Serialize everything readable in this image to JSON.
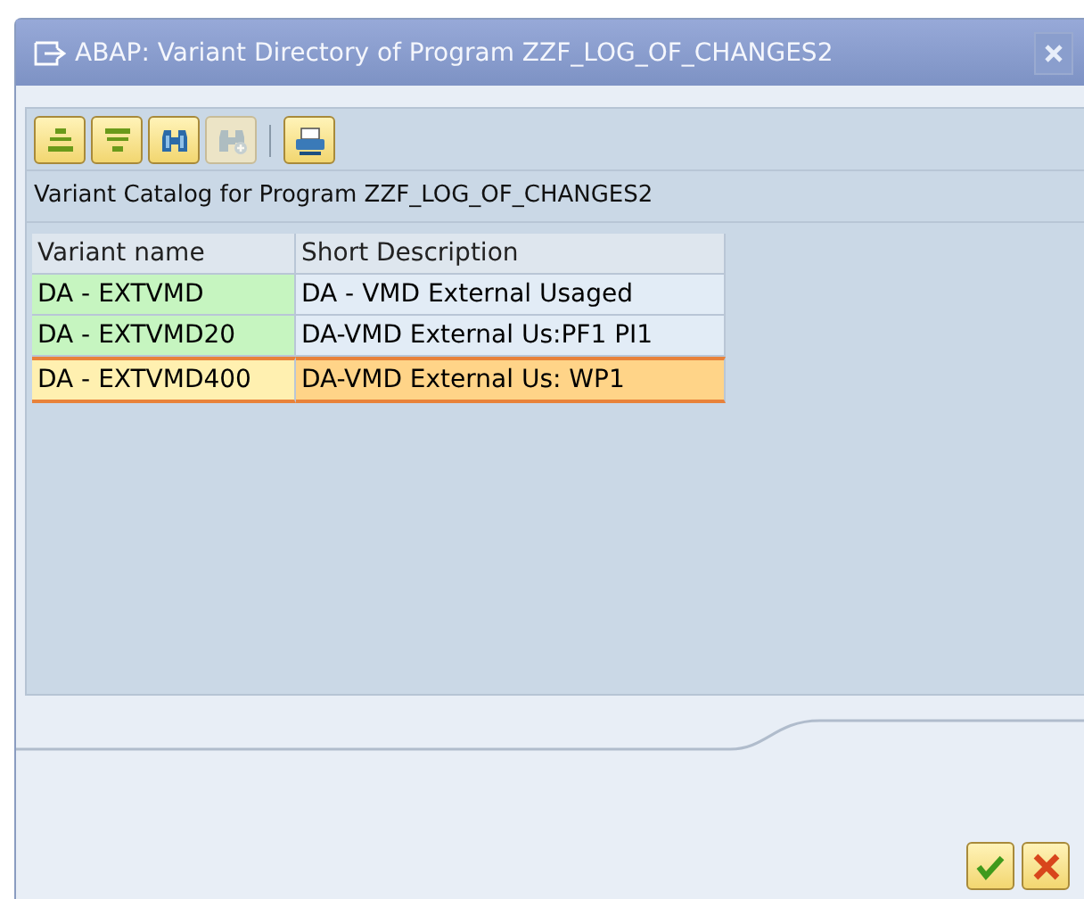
{
  "window": {
    "title": "ABAP: Variant Directory of Program ZZF_LOG_OF_CHANGES2"
  },
  "toolbar_groups": [
    {
      "buttons": [
        {
          "kind": "expand",
          "disabled": false
        },
        {
          "kind": "collapse",
          "disabled": false
        },
        {
          "kind": "find",
          "disabled": false
        },
        {
          "kind": "find-next",
          "disabled": true
        }
      ]
    },
    {
      "buttons": [
        {
          "kind": "print",
          "disabled": false
        }
      ]
    }
  ],
  "caption": "Variant Catalog for Program ZZF_LOG_OF_CHANGES2",
  "table": {
    "columns": [
      "Variant name",
      "Short Description"
    ],
    "rows": [
      {
        "cells": [
          "DA - EXTVMD",
          "DA - VMD External Usaged"
        ],
        "selected": false
      },
      {
        "cells": [
          "DA - EXTVMD20",
          "DA-VMD External Us:PF1 PI1"
        ],
        "selected": false
      },
      {
        "cells": [
          "DA - EXTVMD400",
          "DA-VMD External Us: WP1"
        ],
        "selected": true
      }
    ]
  },
  "footer": [
    {
      "kind": "ok"
    },
    {
      "kind": "cancel"
    }
  ]
}
